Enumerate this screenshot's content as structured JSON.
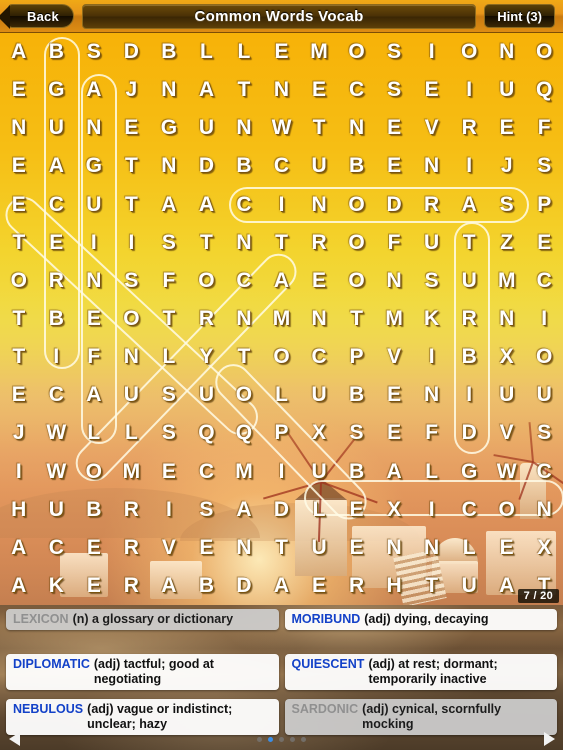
{
  "header": {
    "back_label": "Back",
    "title": "Common Words Vocab",
    "hint_label": "Hint (3)"
  },
  "grid": {
    "columns": 15,
    "rows": 15,
    "letters": [
      [
        "A",
        "B",
        "S",
        "D",
        "B",
        "L",
        "L",
        "E",
        "M",
        "O",
        "S",
        "I",
        "O",
        "N",
        "O"
      ],
      [
        "E",
        "G",
        "A",
        "J",
        "N",
        "A",
        "T",
        "N",
        "E",
        "C",
        "S",
        "E",
        "I",
        "U",
        "Q"
      ],
      [
        "N",
        "U",
        "N",
        "E",
        "G",
        "U",
        "N",
        "W",
        "T",
        "N",
        "E",
        "V",
        "R",
        "E",
        "F"
      ],
      [
        "E",
        "A",
        "G",
        "T",
        "N",
        "D",
        "B",
        "C",
        "U",
        "B",
        "E",
        "N",
        "I",
        "J",
        "S"
      ],
      [
        "E",
        "C",
        "U",
        "T",
        "A",
        "A",
        "C",
        "I",
        "N",
        "O",
        "D",
        "R",
        "A",
        "S",
        "P"
      ],
      [
        "T",
        "E",
        "I",
        "I",
        "S",
        "T",
        "N",
        "T",
        "R",
        "O",
        "F",
        "U",
        "T",
        "Z",
        "E"
      ],
      [
        "O",
        "R",
        "N",
        "S",
        "F",
        "O",
        "C",
        "A",
        "E",
        "O",
        "N",
        "S",
        "U",
        "M",
        "C"
      ],
      [
        "T",
        "B",
        "E",
        "O",
        "T",
        "R",
        "N",
        "M",
        "N",
        "T",
        "M",
        "K",
        "R",
        "N",
        "I"
      ],
      [
        "T",
        "I",
        "F",
        "N",
        "L",
        "Y",
        "T",
        "O",
        "C",
        "P",
        "V",
        "I",
        "B",
        "X",
        "O"
      ],
      [
        "E",
        "C",
        "A",
        "U",
        "S",
        "U",
        "O",
        "L",
        "U",
        "B",
        "E",
        "N",
        "I",
        "U",
        "U"
      ],
      [
        "J",
        "W",
        "L",
        "L",
        "S",
        "Q",
        "Q",
        "P",
        "X",
        "S",
        "E",
        "F",
        "D",
        "V",
        "S"
      ],
      [
        "I",
        "W",
        "O",
        "M",
        "E",
        "C",
        "M",
        "I",
        "U",
        "B",
        "A",
        "L",
        "G",
        "W",
        "C"
      ],
      [
        "H",
        "U",
        "B",
        "R",
        "I",
        "S",
        "A",
        "D",
        "L",
        "E",
        "X",
        "I",
        "C",
        "O",
        "N"
      ],
      [
        "A",
        "C",
        "E",
        "R",
        "V",
        "E",
        "N",
        "T",
        "U",
        "E",
        "N",
        "N",
        "L",
        "E",
        "X"
      ],
      [
        "A",
        "K",
        "E",
        "R",
        "A",
        "B",
        "D",
        "A",
        "E",
        "R",
        "H",
        "T",
        "U",
        "A",
        "T"
      ]
    ],
    "progress": "7 / 20"
  },
  "words": [
    {
      "word": "LEXICON",
      "definition": "(n) a glossary or dictionary",
      "found": true
    },
    {
      "word": "MORIBUND",
      "definition": "(adj) dying, decaying",
      "found": false
    },
    {
      "word": "DIPLOMATIC",
      "definition": "(adj) tactful; good at negotiating",
      "found": false
    },
    {
      "word": "QUIESCENT",
      "definition": "(adj) at rest; dormant; temporarily inactive",
      "found": false
    },
    {
      "word": "NEBULOUS",
      "definition": "(adj) vague or indistinct; unclear; hazy",
      "found": false
    },
    {
      "word": "SARDONIC",
      "definition": "(adj) cynical, scornfully mocking",
      "found": true
    }
  ],
  "bottom_nav": {
    "prev_icon": "left-triangle-icon",
    "next_icon": "right-triangle-icon",
    "page_count": 5,
    "active_page": 2
  },
  "colors": {
    "accent_word": "#1341c8",
    "found_word": "#909090",
    "grid_top": "#f7b208",
    "grid_mid": "#f0dc45"
  }
}
